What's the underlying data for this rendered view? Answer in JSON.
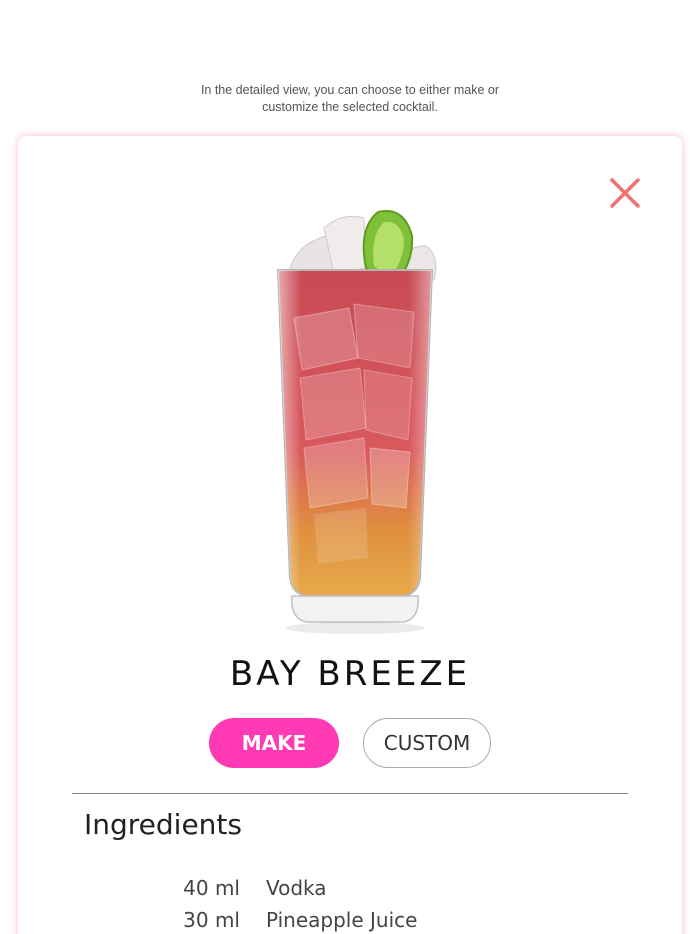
{
  "caption": {
    "line1": "In the detailed view, you can choose to either make or",
    "line2": "customize the selected cocktail."
  },
  "drink": {
    "name": "BAY BREEZE"
  },
  "actions": {
    "make_label": "MAKE",
    "custom_label": "CUSTOM"
  },
  "ingredients": {
    "heading": "Ingredients",
    "items": [
      {
        "qty": "40 ml",
        "name": "Vodka"
      },
      {
        "qty": "30 ml",
        "name": "Pineapple Juice"
      }
    ]
  },
  "icons": {
    "close": "close-icon",
    "drink": "cocktail-glass-image"
  },
  "colors": {
    "accent": "#ff3ab4",
    "close": "#f07070",
    "card_glow": "#ffb0c8"
  }
}
